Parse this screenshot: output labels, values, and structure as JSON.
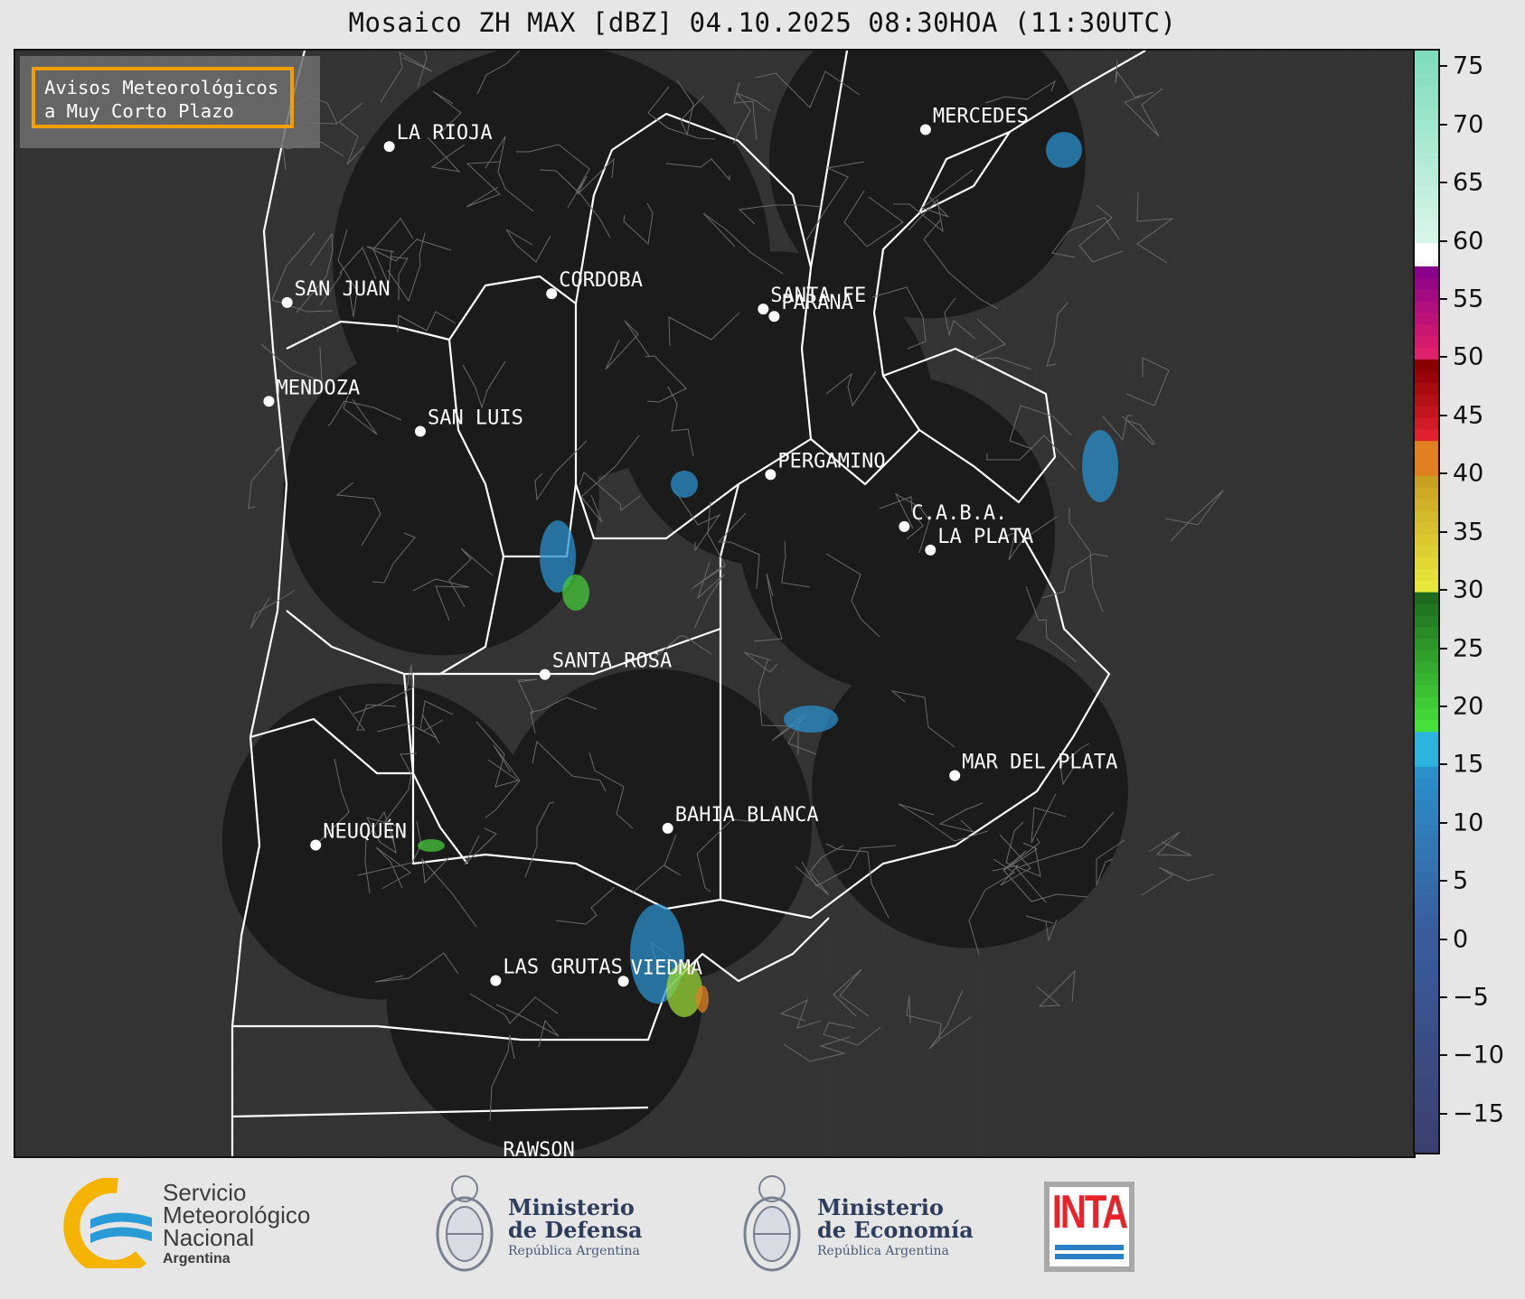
{
  "title": "Mosaico ZH MAX [dBZ] 04.10.2025 08:30HOA (11:30UTC)",
  "warning_box": {
    "line1": "Avisos Meteorológicos",
    "line2": "a Muy Corto Plazo",
    "border_color": "#f2a000"
  },
  "cities": [
    {
      "name": "LA RIOJA",
      "lon": -66.85,
      "lat": -29.41
    },
    {
      "name": "SAN JUAN",
      "lon": -68.53,
      "lat": -31.54
    },
    {
      "name": "CORDOBA",
      "lon": -64.18,
      "lat": -31.42
    },
    {
      "name": "SANTA FE",
      "lon": -60.7,
      "lat": -31.63
    },
    {
      "name": "PARANA",
      "lon": -60.52,
      "lat": -31.73
    },
    {
      "name": "MERCEDES",
      "lon": -58.03,
      "lat": -29.18
    },
    {
      "name": "MENDOZA",
      "lon": -68.83,
      "lat": -32.89
    },
    {
      "name": "SAN LUIS",
      "lon": -66.34,
      "lat": -33.3
    },
    {
      "name": "PERGAMINO",
      "lon": -60.58,
      "lat": -33.89
    },
    {
      "name": "C.A.B.A.",
      "lon": -58.38,
      "lat": -34.6
    },
    {
      "name": "LA PLATA",
      "lon": -57.95,
      "lat": -34.92
    },
    {
      "name": "SANTA ROSA",
      "lon": -64.29,
      "lat": -36.62
    },
    {
      "name": "MAR DEL PLATA",
      "lon": -57.55,
      "lat": -38.0
    },
    {
      "name": "BAHIA BLANCA",
      "lon": -62.27,
      "lat": -38.72
    },
    {
      "name": "NEUQUÉN",
      "lon": -68.06,
      "lat": -38.95
    },
    {
      "name": "LAS GRUTAS",
      "lon": -65.1,
      "lat": -40.8
    },
    {
      "name": "VIEDMA",
      "lon": -63.0,
      "lat": -40.81
    },
    {
      "name": "RAWSON",
      "lon": -65.1,
      "lat": -43.3
    }
  ],
  "colorbar": {
    "label_unit": "dBZ",
    "ticks": [
      "75",
      "70",
      "65",
      "60",
      "55",
      "50",
      "45",
      "40",
      "35",
      "30",
      "25",
      "20",
      "15",
      "10",
      "5",
      "0",
      "−5",
      "−10",
      "−15"
    ],
    "min": -18.5,
    "max": 76.5,
    "stops": [
      {
        "from": -18.5,
        "to": 0,
        "color_from": "#3b3f6e",
        "color_to": "#3a5a9a"
      },
      {
        "from": 0,
        "to": 15,
        "color_from": "#3a5a9a",
        "color_to": "#2b8fc9"
      },
      {
        "from": 15,
        "to": 18,
        "color_from": "#2bb4dd",
        "color_to": "#2bb4dd"
      },
      {
        "from": 18,
        "to": 30,
        "color_from": "#45e03a",
        "color_to": "#1f6a1f"
      },
      {
        "from": 30,
        "to": 40,
        "color_from": "#e8e83a",
        "color_to": "#c8a020"
      },
      {
        "from": 40,
        "to": 43,
        "color_from": "#e08020",
        "color_to": "#e08020"
      },
      {
        "from": 43,
        "to": 50,
        "color_from": "#e02030",
        "color_to": "#8a0000"
      },
      {
        "from": 50,
        "to": 58,
        "color_from": "#e0206a",
        "color_to": "#8a008a"
      },
      {
        "from": 58,
        "to": 60,
        "color_from": "#ffffff",
        "color_to": "#ffffff"
      },
      {
        "from": 60,
        "to": 76.5,
        "color_from": "#d8f5ea",
        "color_to": "#7fdcbc"
      }
    ]
  },
  "map_bounds": {
    "lon_min": -73.0,
    "lon_max": -50.0,
    "lat_min": -43.2,
    "lat_max": -28.1
  },
  "radars": [
    {
      "lon": -64.18,
      "lat": -31.0,
      "radius_deg": 3.6
    },
    {
      "lon": -66.0,
      "lat": -34.2,
      "radius_deg": 2.6
    },
    {
      "lon": -67.0,
      "lat": -38.9,
      "radius_deg": 2.6
    },
    {
      "lon": -64.3,
      "lat": -41.0,
      "radius_deg": 2.6
    },
    {
      "lon": -62.5,
      "lat": -38.7,
      "radius_deg": 2.6
    },
    {
      "lon": -58.5,
      "lat": -34.7,
      "radius_deg": 2.6
    },
    {
      "lon": -57.3,
      "lat": -38.2,
      "radius_deg": 2.6
    },
    {
      "lon": -60.5,
      "lat": -33.0,
      "radius_deg": 2.6
    },
    {
      "lon": -58.0,
      "lat": -29.6,
      "radius_deg": 2.6
    }
  ],
  "footer": {
    "smn": {
      "line1": "Servicio",
      "line2": "Meteorológico",
      "line3": "Nacional",
      "line4": "Argentina"
    },
    "defensa": {
      "line1": "Ministerio",
      "line2": "de Defensa",
      "line3": "República Argentina"
    },
    "economia": {
      "line1": "Ministerio",
      "line2": "de Economía",
      "line3": "República Argentina"
    },
    "inta": {
      "text": "INTA",
      "color": "#e8232a"
    }
  }
}
